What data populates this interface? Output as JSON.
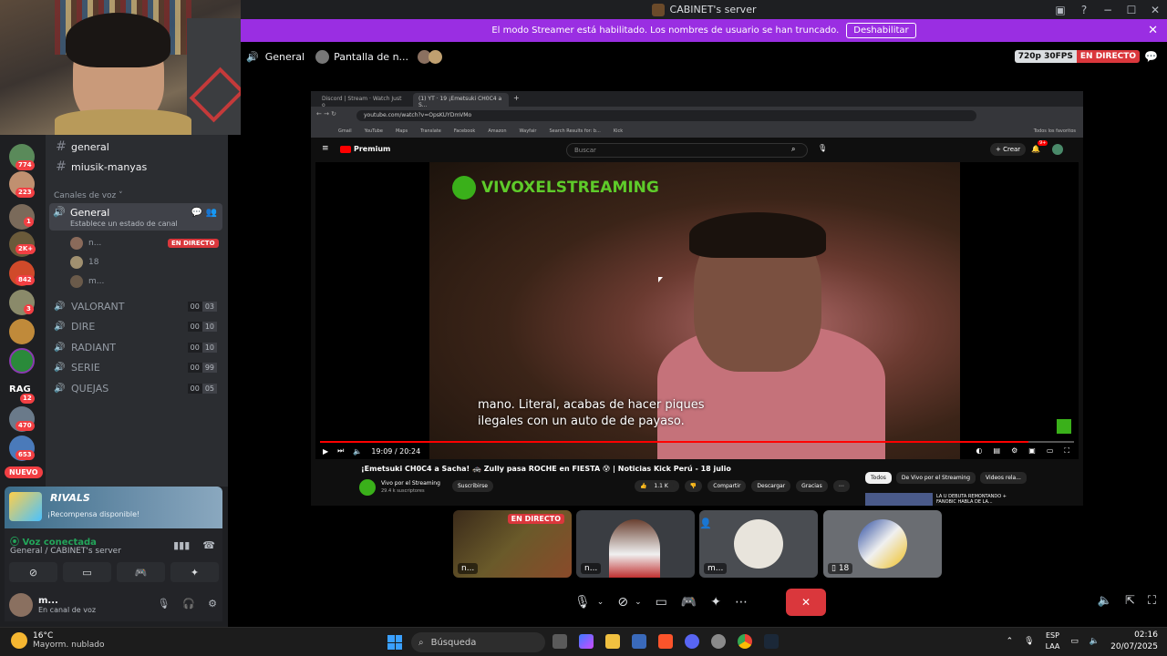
{
  "window": {
    "title": "CABINET's server",
    "controls": [
      "−",
      "☐",
      "✕"
    ]
  },
  "banner": {
    "message": "El modo Streamer está habilitado. Los nombres de usuario se han truncado.",
    "button": "Deshabilitar"
  },
  "stream_header": {
    "channel": "General",
    "stream_label": "Pantalla de n...",
    "quality": "720p 30FPS",
    "live": "EN DIRECTO"
  },
  "guilds": [
    {
      "badge": "774",
      "color": "#5a8a5a"
    },
    {
      "badge": "223",
      "color": "#c09070"
    },
    {
      "badge": "1",
      "color": "#7a6a5a"
    },
    {
      "badge": "2K+",
      "color": "#6a5a3a"
    },
    {
      "badge": "842",
      "color": "#d04a2a"
    },
    {
      "badge": "3",
      "color": "#8a8a6a"
    },
    {
      "badge": "",
      "color": "#c08a3a"
    },
    {
      "badge": "",
      "color": "#2a8a3a"
    },
    {
      "badge": "12",
      "color": "#3a3a3a",
      "label": "RAG"
    },
    {
      "badge": "470",
      "color": "#6a7a8a"
    },
    {
      "badge": "653",
      "color": "#4a7aba"
    }
  ],
  "nuevo": "NUEVO",
  "text_channels": [
    "general",
    "miusik-manyas"
  ],
  "voice_section_label": "Canales de voz",
  "active_voice": {
    "name": "General",
    "status": "Establece un estado de canal"
  },
  "voice_users": [
    {
      "name": "n...",
      "live": "EN DIRECTO"
    },
    {
      "name": "18",
      "live": ""
    },
    {
      "name": "m...",
      "live": ""
    }
  ],
  "voice_channels": [
    {
      "name": "VALORANT",
      "count": "00",
      "limit": "03"
    },
    {
      "name": "DIRE",
      "count": "00",
      "limit": "10"
    },
    {
      "name": "RADIANT",
      "count": "00",
      "limit": "10"
    },
    {
      "name": "SERIE",
      "count": "00",
      "limit": "99"
    },
    {
      "name": "QUEJAS",
      "count": "00",
      "limit": "05"
    }
  ],
  "rivals": {
    "title": "RIVALS",
    "subtitle": "¡Recompensa disponible!"
  },
  "voice_panel": {
    "status": "Voz conectada",
    "location": "General / CABINET's server"
  },
  "user_panel": {
    "name": "m...",
    "status": "En canal de voz"
  },
  "browser": {
    "tabs": [
      "Discord | Stream · Watch Just o",
      "(1) YT · 19 ¡Emetsuki CH0C4 a S..."
    ],
    "url": "youtube.com/watch?v=OpsKUYDmVMo",
    "bookmarks": [
      "Gmail",
      "YouTube",
      "Maps",
      "Translate",
      "Facebook",
      "Amazon",
      "Wayfair",
      "Search Results for: b...",
      "Kick"
    ],
    "bookmarks_right": "Todos los favoritos",
    "yt_logo": "Premium",
    "search_placeholder": "Buscar",
    "create": "+ Crear",
    "notif_count": "9+",
    "video_logo_text": "VIVOXELSTREAMING",
    "subtitle_line1": "mano. Literal, acabas de hacer piques",
    "subtitle_line2": "ilegales con un auto de de payaso.",
    "time": "19:09 / 20:24",
    "progress": 0.94,
    "video_title": "¡Emetsuki CH0C4 a Sacha! 🚓 Zully pasa ROCHE en FIESTA 😰 | Noticias Kick Perú - 18 julio",
    "channel_name": "Vivo por el Streaming",
    "channel_subs": "29.4 k suscriptores",
    "subscribe": "Suscribirse",
    "likes": "1.1 K",
    "share": "Compartir",
    "download": "Descargar",
    "thanks": "Gracias",
    "chips": [
      "Todos",
      "De Vivo por el Streaming",
      "Videos rela..."
    ],
    "side_video_title": "LA U DEBUTA REMONTANDO + FANOBIC HABLA DE LA..."
  },
  "tiles": [
    {
      "label": "n...",
      "live": "EN DIRECTO"
    },
    {
      "label": "n...",
      "live": ""
    },
    {
      "label": "m...",
      "live": ""
    },
    {
      "label": "18",
      "live": ""
    }
  ],
  "taskbar": {
    "temp": "16°C",
    "weather": "Mayorm. nublado",
    "search": "Búsqueda",
    "lang1": "ESP",
    "lang2": "LAA",
    "time": "02:16",
    "date": "20/07/2025"
  }
}
